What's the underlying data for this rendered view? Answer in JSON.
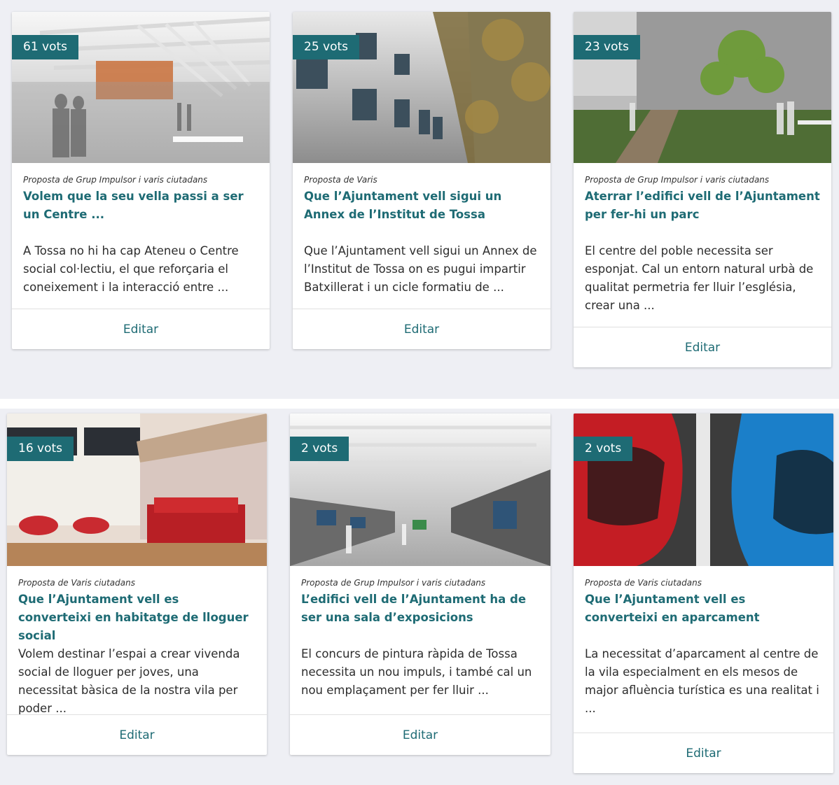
{
  "proposals": [
    {
      "votes": "61 vots",
      "author": "Proposta de Grup Impulsor i varis ciutadans",
      "title": "Volem que la seu vella passi a ser un Centre ...",
      "description": "A Tossa no hi ha cap Ateneu o Centre social col·lectiu, el que reforçaria el coneixement i la interacció entre ...",
      "action": "Editar",
      "image": "interior-render-icon"
    },
    {
      "votes": "25 vots",
      "author": "Proposta de Varis",
      "title": "Que l’Ajuntament vell sigui un Annex de l’Institut de Tossa",
      "description": "Que l’Ajuntament vell sigui un Annex de l’Institut de Tossa on es pugui impartir Batxillerat i un cicle formatiu de ...",
      "action": "Editar",
      "image": "building-facade-icon"
    },
    {
      "votes": "23 vots",
      "author": "Proposta de Grup Impulsor i varis ciutadans",
      "title": "Aterrar l’edifici vell de l’Ajuntament per fer-hi un parc",
      "description": "El centre del poble necessita ser esponjat. Cal un entorn natural urbà de qualitat permetria fer lluir l’església, crear una ...",
      "action": "Editar",
      "image": "park-render-icon"
    },
    {
      "votes": "16 vots",
      "author": "Proposta de Varis ciutadans",
      "title": "Que l’Ajuntament vell es converteixi en habitatge de lloguer social",
      "description": "Volem destinar l’espai a crear vivenda social de lloguer per joves, una necessitat bàsica de la nostra vila per poder ...",
      "action": "Editar",
      "image": "living-room-icon"
    },
    {
      "votes": "2 vots",
      "author": "Proposta de Grup Impulsor i varis ciutadans",
      "title": "L’edifici vell de l’Ajuntament ha de ser una sala d’exposicions",
      "description": "El concurs de pintura ràpida de Tossa necessita un nou impuls, i també cal un nou emplaçament per fer lluir ...",
      "action": "Editar",
      "image": "gallery-render-icon"
    },
    {
      "votes": "2 vots",
      "author": "Proposta de Varis ciutadans",
      "title": "Que l’Ajuntament vell es converteixi en aparcament",
      "description": "La necessitat d’aparcament al centre de la vila especialment en els mesos de major afluència turística es una realitat i ...",
      "action": "Editar",
      "image": "parked-cars-icon"
    }
  ]
}
